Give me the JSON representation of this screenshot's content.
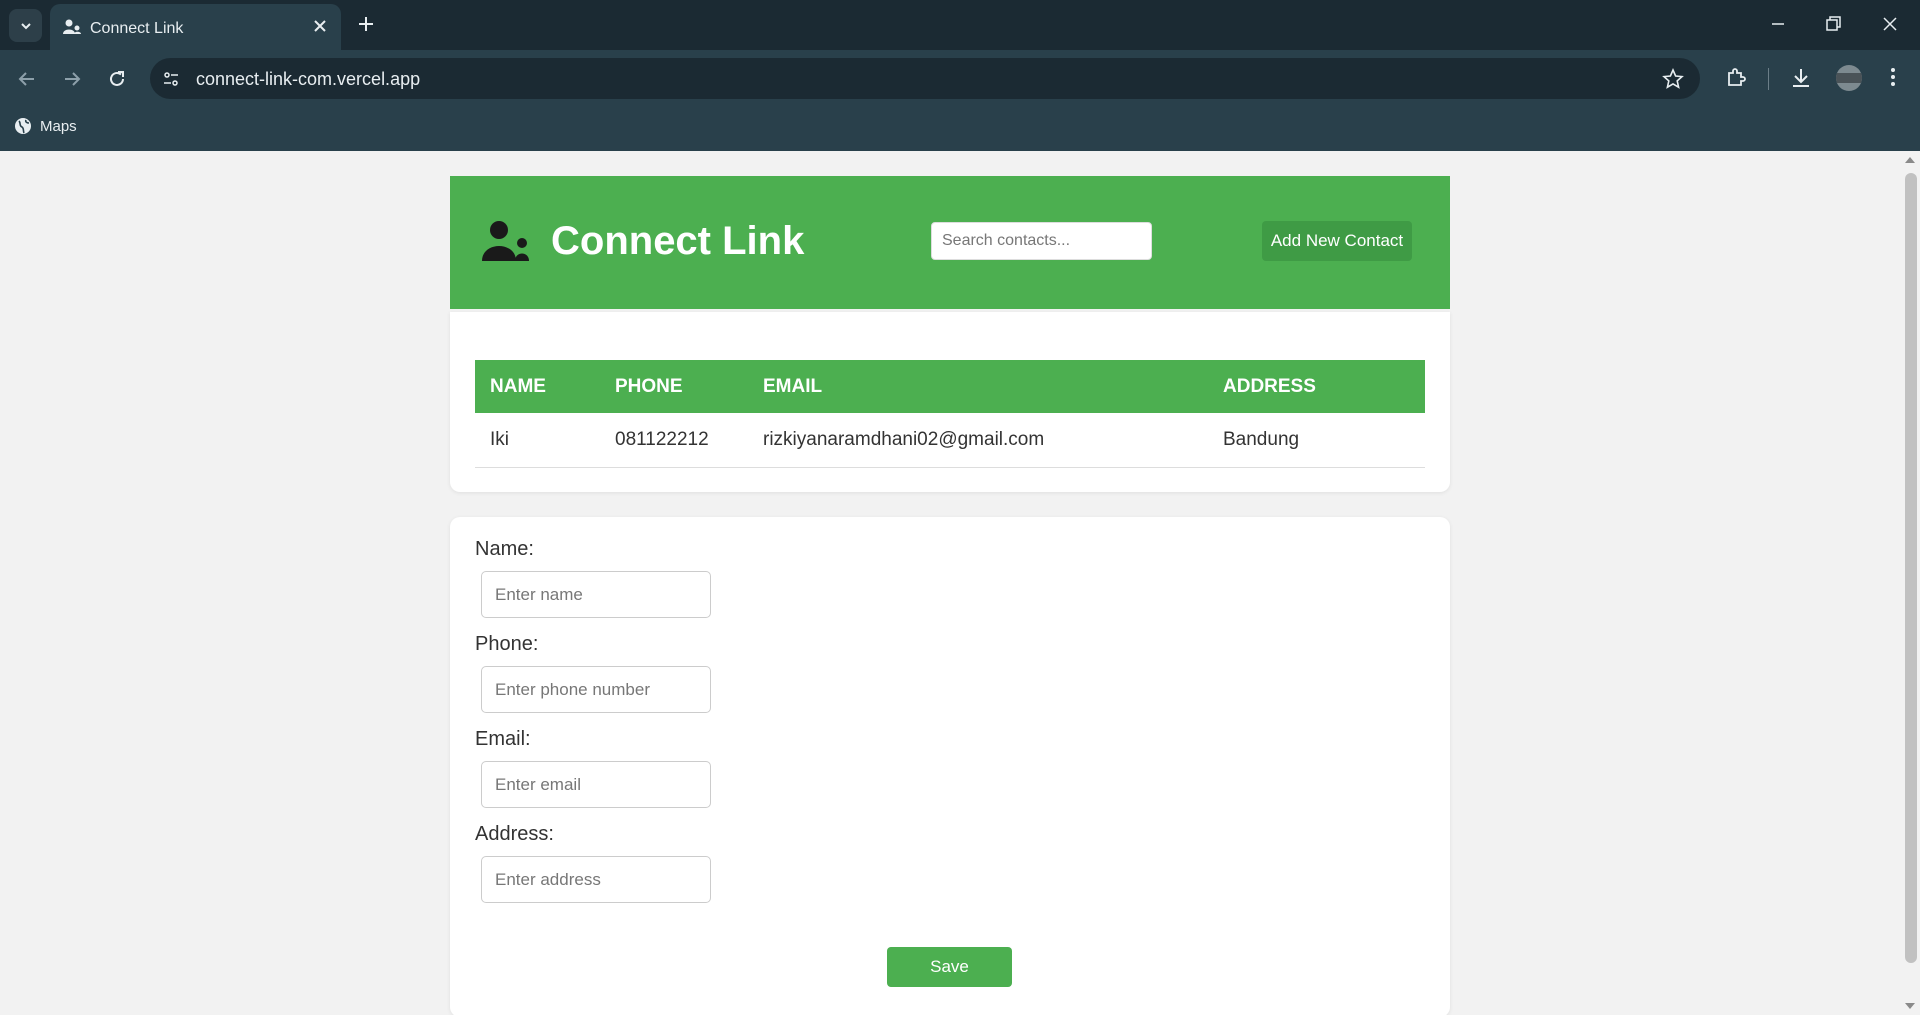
{
  "browser": {
    "tab_title": "Connect Link",
    "url": "connect-link-com.vercel.app",
    "bookmarks": [
      {
        "label": "Maps"
      }
    ]
  },
  "app": {
    "title": "Connect Link",
    "search_placeholder": "Search contacts...",
    "add_button_label": "Add New Contact",
    "brand_color": "#4caf50"
  },
  "table": {
    "headers": [
      "NAME",
      "PHONE",
      "EMAIL",
      "ADDRESS"
    ],
    "rows": [
      {
        "name": "Iki",
        "phone": "081122212",
        "email": "rizkiyanaramdhani02@gmail.com",
        "address": "Bandung"
      }
    ]
  },
  "form": {
    "fields": [
      {
        "label": "Name:",
        "placeholder": "Enter name"
      },
      {
        "label": "Phone:",
        "placeholder": "Enter phone number"
      },
      {
        "label": "Email:",
        "placeholder": "Enter email"
      },
      {
        "label": "Address:",
        "placeholder": "Enter address"
      }
    ],
    "save_label": "Save"
  }
}
